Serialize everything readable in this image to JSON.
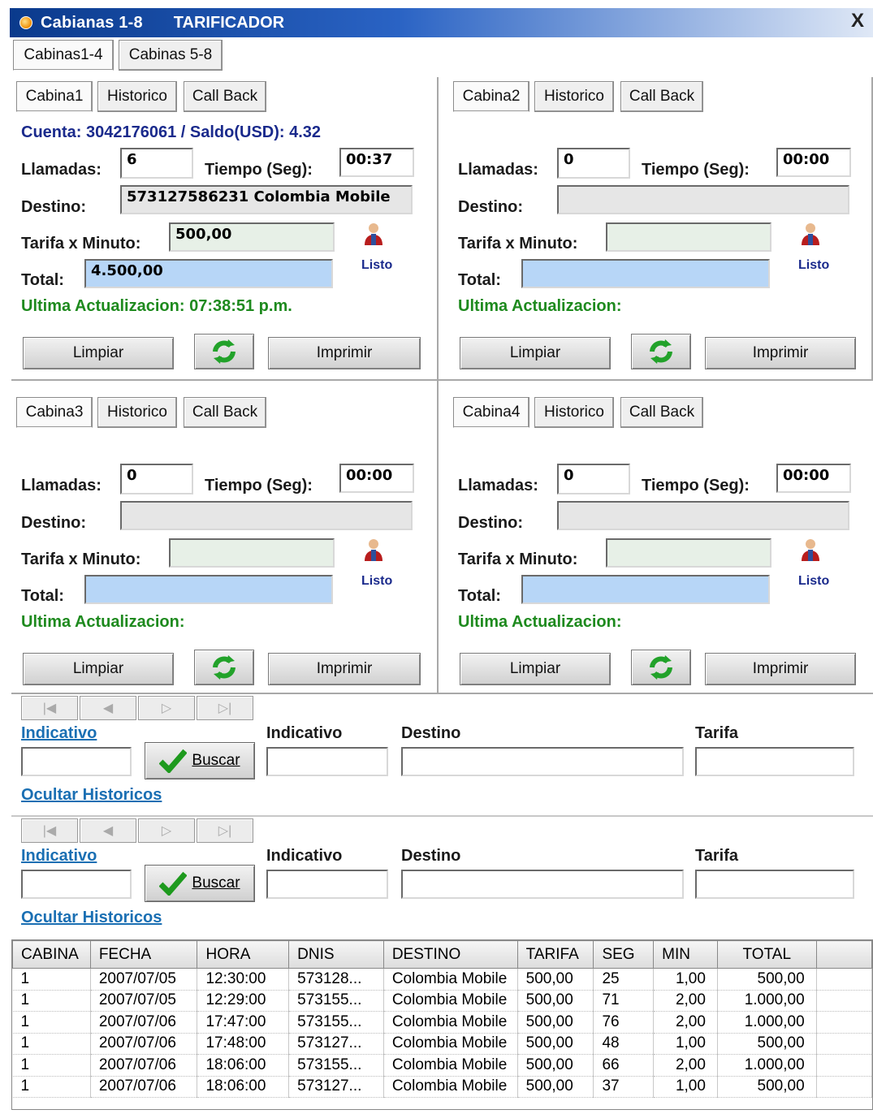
{
  "window": {
    "title": "Cabianas 1-8",
    "subtitle": "TARIFICADOR",
    "close_label": "X"
  },
  "top_tabs": [
    {
      "label": "Cabinas1-4"
    },
    {
      "label": "Cabinas 5-8"
    }
  ],
  "labels": {
    "llamadas": "Llamadas:",
    "tiempo": "Tiempo (Seg):",
    "destino": "Destino:",
    "tarifa": "Tarifa x Minuto:",
    "total": "Total:",
    "listo": "Listo",
    "limpiar": "Limpiar",
    "imprimir": "Imprimir",
    "historico": "Historico",
    "callback": "Call Back"
  },
  "cabinas": [
    {
      "tab": "Cabina1",
      "cuenta": "Cuenta: 3042176061 / Saldo(USD): 4.32",
      "llamadas": "6",
      "tiempo": "00:37",
      "destino": "573127586231  Colombia Mobile",
      "tarifa": "500,00",
      "total": "4.500,00",
      "ultima": "Ultima Actualizacion: 07:38:51 p.m."
    },
    {
      "tab": "Cabina2",
      "cuenta": "",
      "llamadas": "0",
      "tiempo": "00:00",
      "destino": "",
      "tarifa": "",
      "total": "",
      "ultima": "Ultima Actualizacion:"
    },
    {
      "tab": "Cabina3",
      "cuenta": "",
      "llamadas": "0",
      "tiempo": "00:00",
      "destino": "",
      "tarifa": "",
      "total": "",
      "ultima": "Ultima Actualizacion:"
    },
    {
      "tab": "Cabina4",
      "cuenta": "",
      "llamadas": "0",
      "tiempo": "00:00",
      "destino": "",
      "tarifa": "",
      "total": "",
      "ultima": "Ultima Actualizacion:"
    }
  ],
  "search": {
    "indicativo_link": "Indicativo",
    "buscar": "Buscar",
    "col_indicativo": "Indicativo",
    "col_destino": "Destino",
    "col_tarifa": "Tarifa",
    "ocultar": "Ocultar Historicos"
  },
  "history_table": {
    "columns": [
      "CABINA",
      "FECHA",
      "HORA",
      "DNIS",
      "DESTINO",
      "TARIFA",
      "SEG",
      "MIN",
      "TOTAL"
    ],
    "rows": [
      [
        "1",
        "2007/07/05",
        "12:30:00",
        "573128...",
        "Colombia Mobile",
        "500,00",
        "25",
        "1,00",
        "500,00"
      ],
      [
        "1",
        "2007/07/05",
        "12:29:00",
        "573155...",
        "Colombia Mobile",
        "500,00",
        "71",
        "2,00",
        "1.000,00"
      ],
      [
        "1",
        "2007/07/06",
        "17:47:00",
        "573155...",
        "Colombia Mobile",
        "500,00",
        "76",
        "2,00",
        "1.000,00"
      ],
      [
        "1",
        "2007/07/06",
        "17:48:00",
        "573127...",
        "Colombia Mobile",
        "500,00",
        "48",
        "1,00",
        "500,00"
      ],
      [
        "1",
        "2007/07/06",
        "18:06:00",
        "573155...",
        "Colombia Mobile",
        "500,00",
        "66",
        "2,00",
        "1.000,00"
      ],
      [
        "1",
        "2007/07/06",
        "18:06:00",
        "573127...",
        "Colombia Mobile",
        "500,00",
        "37",
        "1,00",
        "500,00"
      ]
    ]
  },
  "colors": {
    "title_bar": "#0a3a8c",
    "account_text": "#1a2a8c",
    "update_text": "#1e8a1e",
    "total_field": "#b7d6f7",
    "link": "#1a6fb3"
  }
}
